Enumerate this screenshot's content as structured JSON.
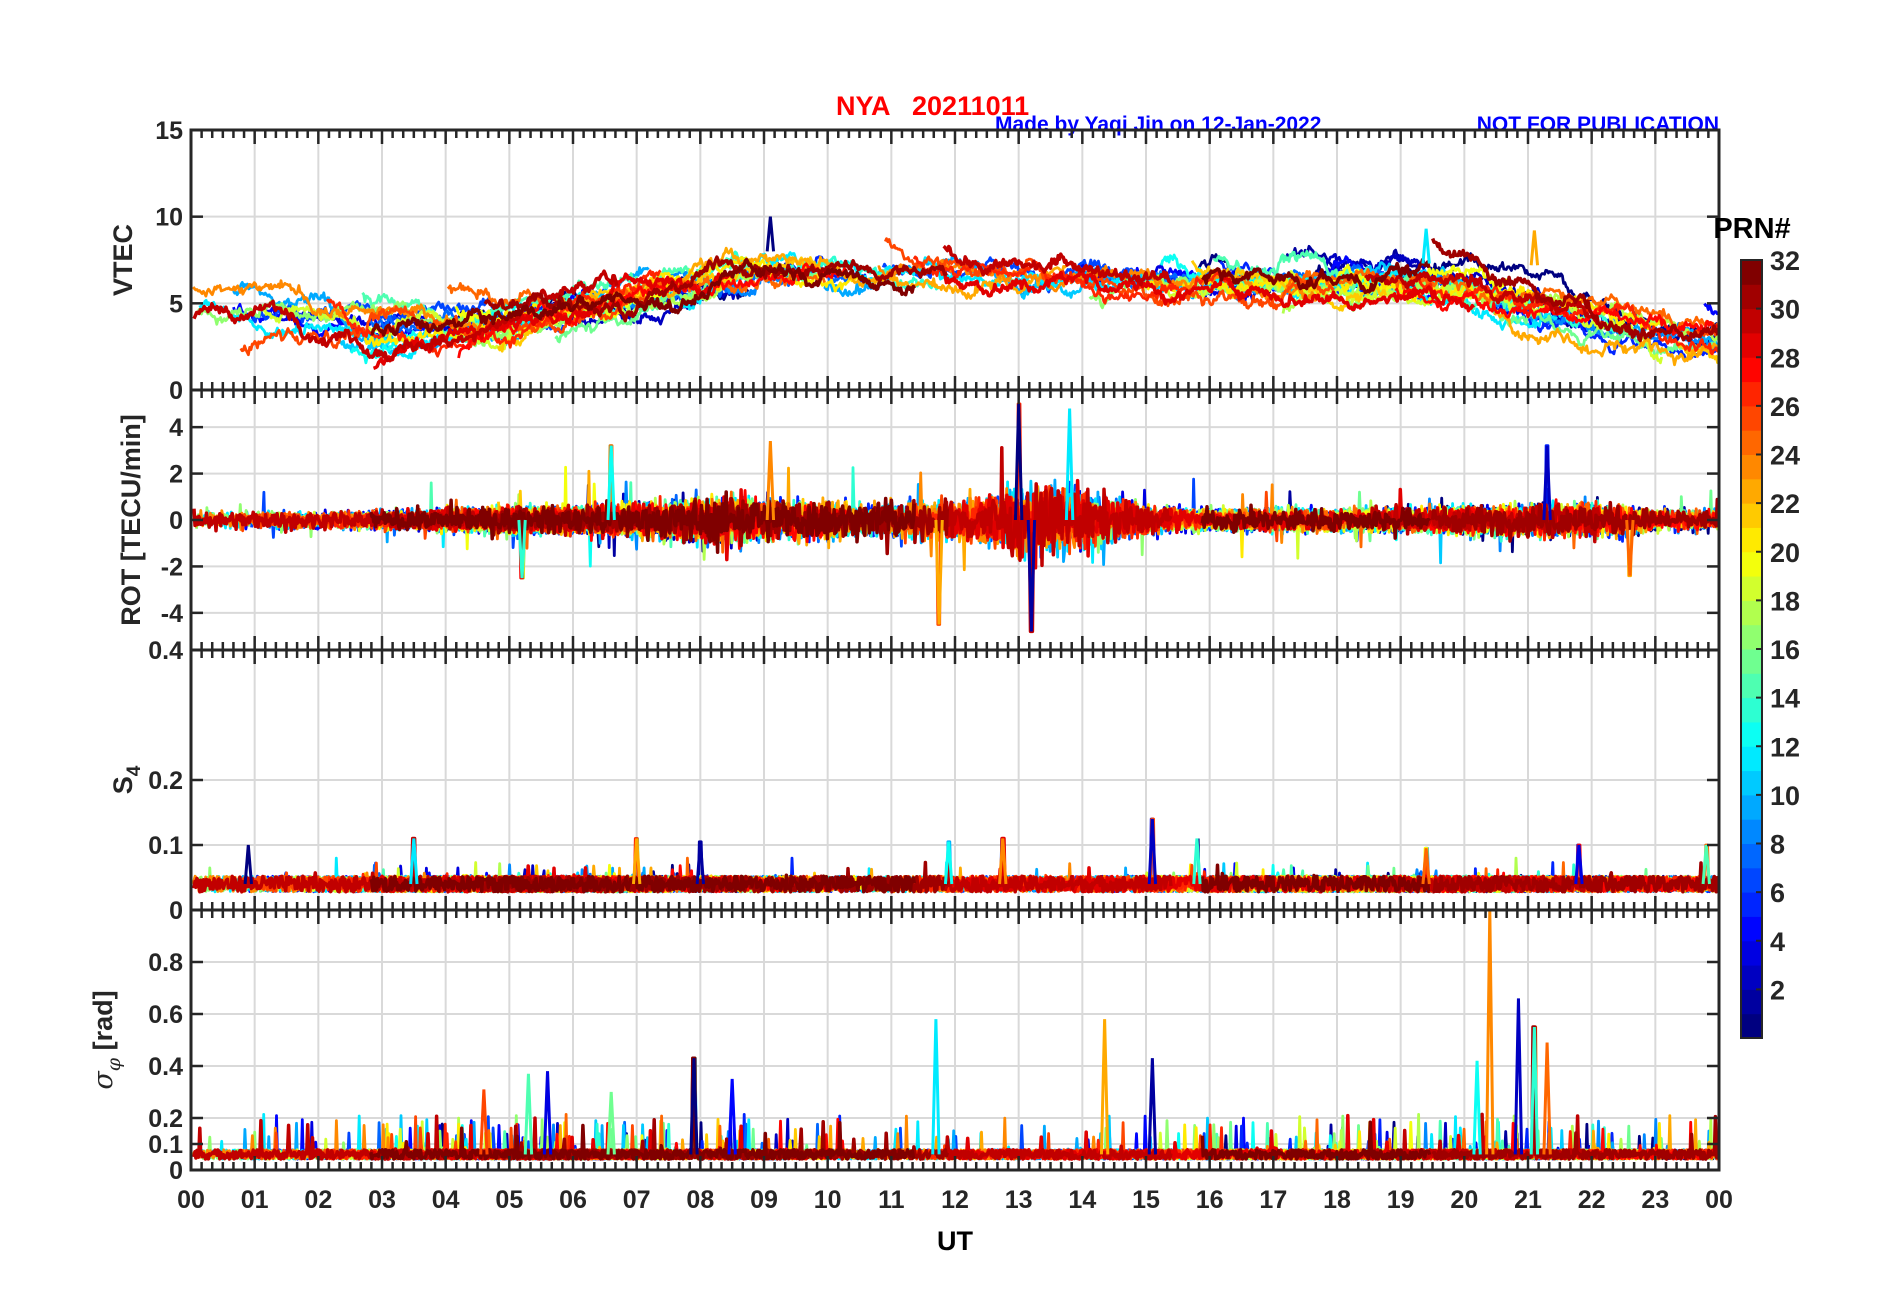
{
  "header": {
    "title": "NYA   20211011",
    "credit": "Made by Yaqi Jin on 12-Jan-2022",
    "notice": "NOT FOR PUBLICATION",
    "title_color": "#ff0000",
    "credit_color": "#0000ff"
  },
  "chart_data": [
    {
      "type": "line",
      "panel": "vtec",
      "ylabel": "VTEC",
      "ylim": [
        0,
        15
      ],
      "yticks": [
        0,
        5,
        10,
        15
      ],
      "ytick_labels": [
        "0",
        "5",
        "10",
        "15"
      ],
      "grid": true,
      "typical_hourly": [
        4.5,
        4.2,
        4.0,
        3.8,
        3.8,
        4.0,
        4.8,
        5.5,
        6.5,
        7.3,
        7.2,
        7.0,
        6.8,
        6.7,
        6.8,
        6.6,
        6.4,
        6.2,
        6.3,
        6.2,
        6.0,
        5.2,
        4.5,
        3.5,
        3.0
      ],
      "annotations": [
        {
          "x": 9.1,
          "y": 10.0
        },
        {
          "x": 19.4,
          "y": 9.3
        },
        {
          "x": 21.1,
          "y": 9.2
        }
      ]
    },
    {
      "type": "line",
      "panel": "rot",
      "ylabel": "ROT [TECU/min]",
      "ylim": [
        -5.6,
        5.6
      ],
      "yticks": [
        -4,
        -2,
        0,
        2,
        4
      ],
      "ytick_labels": [
        "-4",
        "-2",
        "0",
        "2",
        "4"
      ],
      "grid": true,
      "noise_hourly": [
        0.4,
        0.4,
        0.35,
        0.4,
        0.5,
        0.6,
        0.6,
        0.7,
        1.0,
        1.0,
        0.9,
        0.8,
        0.9,
        1.5,
        1.4,
        0.6,
        0.5,
        0.5,
        0.5,
        0.5,
        0.6,
        0.7,
        0.8,
        0.5,
        0.4
      ],
      "peaks": [
        {
          "x": 13.0,
          "y": 5.0
        },
        {
          "x": 13.8,
          "y": 4.8
        },
        {
          "x": 11.75,
          "y": -4.5
        },
        {
          "x": 13.2,
          "y": -4.8
        },
        {
          "x": 6.6,
          "y": 3.2
        },
        {
          "x": 9.1,
          "y": 3.4
        },
        {
          "x": 21.3,
          "y": 3.2
        },
        {
          "x": 5.2,
          "y": -2.5
        },
        {
          "x": 22.6,
          "y": -2.4
        }
      ]
    },
    {
      "type": "line",
      "panel": "s4",
      "ylabel": "S4",
      "ylim": [
        0,
        0.4
      ],
      "yticks": [
        0,
        0.1,
        0.2,
        0.4
      ],
      "ytick_labels": [
        "0",
        "0.1",
        "0.2",
        "0.4"
      ],
      "grid": true,
      "baseline": 0.04,
      "peaks": [
        {
          "x": 0.9,
          "y": 0.1
        },
        {
          "x": 3.5,
          "y": 0.11
        },
        {
          "x": 7.0,
          "y": 0.11
        },
        {
          "x": 8.0,
          "y": 0.105
        },
        {
          "x": 11.9,
          "y": 0.105
        },
        {
          "x": 12.75,
          "y": 0.11
        },
        {
          "x": 15.1,
          "y": 0.14
        },
        {
          "x": 15.8,
          "y": 0.11
        },
        {
          "x": 19.4,
          "y": 0.095
        },
        {
          "x": 21.8,
          "y": 0.1
        },
        {
          "x": 23.8,
          "y": 0.1
        }
      ]
    },
    {
      "type": "line",
      "panel": "sigma_phi",
      "ylabel": "σφ [rad]",
      "ylabel_main": "σ",
      "ylabel_sub": "φ",
      "ylabel_unit": "[rad]",
      "ylim": [
        0,
        1
      ],
      "yticks": [
        0,
        0.1,
        0.2,
        0.4,
        0.6,
        0.8
      ],
      "ytick_labels": [
        "0",
        "0.1",
        "0.2",
        "0.4",
        "0.6",
        "0.8"
      ],
      "grid": true,
      "baseline": 0.06,
      "peaks": [
        {
          "x": 7.9,
          "y": 0.43
        },
        {
          "x": 11.7,
          "y": 0.58
        },
        {
          "x": 14.35,
          "y": 0.58
        },
        {
          "x": 15.1,
          "y": 0.43
        },
        {
          "x": 20.2,
          "y": 0.42
        },
        {
          "x": 20.4,
          "y": 1.0
        },
        {
          "x": 20.85,
          "y": 0.66
        },
        {
          "x": 21.1,
          "y": 0.55
        },
        {
          "x": 21.3,
          "y": 0.49
        },
        {
          "x": 5.6,
          "y": 0.38
        },
        {
          "x": 5.3,
          "y": 0.37
        },
        {
          "x": 4.6,
          "y": 0.31
        },
        {
          "x": 8.5,
          "y": 0.35
        },
        {
          "x": 6.6,
          "y": 0.3
        }
      ]
    }
  ],
  "xaxis": {
    "label": "UT",
    "xlim": [
      0,
      24
    ],
    "tick_labels": [
      "00",
      "01",
      "02",
      "03",
      "04",
      "05",
      "06",
      "07",
      "08",
      "09",
      "10",
      "11",
      "12",
      "13",
      "14",
      "15",
      "16",
      "17",
      "18",
      "19",
      "20",
      "21",
      "22",
      "23",
      "00"
    ]
  },
  "colorbar": {
    "label": "PRN#",
    "range": [
      1,
      32
    ],
    "colormap": "jet",
    "tick_labels": [
      "2",
      "4",
      "6",
      "8",
      "10",
      "12",
      "14",
      "16",
      "18",
      "20",
      "22",
      "24",
      "26",
      "28",
      "30",
      "32"
    ]
  },
  "series_names": "PRN 1-32"
}
